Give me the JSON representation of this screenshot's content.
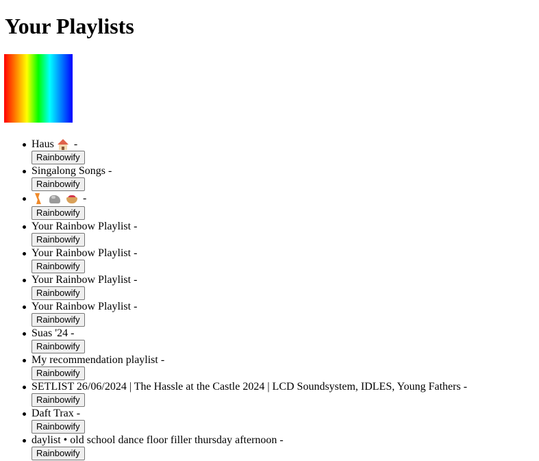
{
  "page": {
    "title": "Your Playlists",
    "rainbow_colors": [
      "#ff0000",
      "#ff7f00",
      "#ffff00",
      "#00ff00",
      "#00ffff",
      "#007fff",
      "#0000ff"
    ]
  },
  "playlists": [
    {
      "name": "Haus",
      "icons": [
        "house-icon"
      ],
      "separator": "-",
      "button_label": "Rainbowify"
    },
    {
      "name": "Singalong Songs",
      "icons": [],
      "separator": "-",
      "button_label": "Rainbowify"
    },
    {
      "name": "",
      "icons": [
        "lightning-icon",
        "rock-icon",
        "pie-icon"
      ],
      "separator": "-",
      "button_label": "Rainbowify"
    },
    {
      "name": "Your Rainbow Playlist",
      "icons": [],
      "separator": "-",
      "button_label": "Rainbowify"
    },
    {
      "name": "Your Rainbow Playlist",
      "icons": [],
      "separator": "-",
      "button_label": "Rainbowify"
    },
    {
      "name": "Your Rainbow Playlist",
      "icons": [],
      "separator": "-",
      "button_label": "Rainbowify"
    },
    {
      "name": "Your Rainbow Playlist",
      "icons": [],
      "separator": "-",
      "button_label": "Rainbowify"
    },
    {
      "name": "Suas '24",
      "icons": [],
      "separator": "-",
      "button_label": "Rainbowify"
    },
    {
      "name": "My recommendation playlist",
      "icons": [],
      "separator": "-",
      "button_label": "Rainbowify"
    },
    {
      "name": "SETLIST 26/06/2024 | The Hassle at the Castle 2024 | LCD Soundsystem, IDLES, Young Fathers",
      "icons": [],
      "separator": "-",
      "button_label": "Rainbowify"
    },
    {
      "name": "Daft Trax",
      "icons": [],
      "separator": "-",
      "button_label": "Rainbowify"
    },
    {
      "name": "daylist • old school dance floor filler thursday afternoon",
      "icons": [],
      "separator": "-",
      "button_label": "Rainbowify"
    }
  ]
}
